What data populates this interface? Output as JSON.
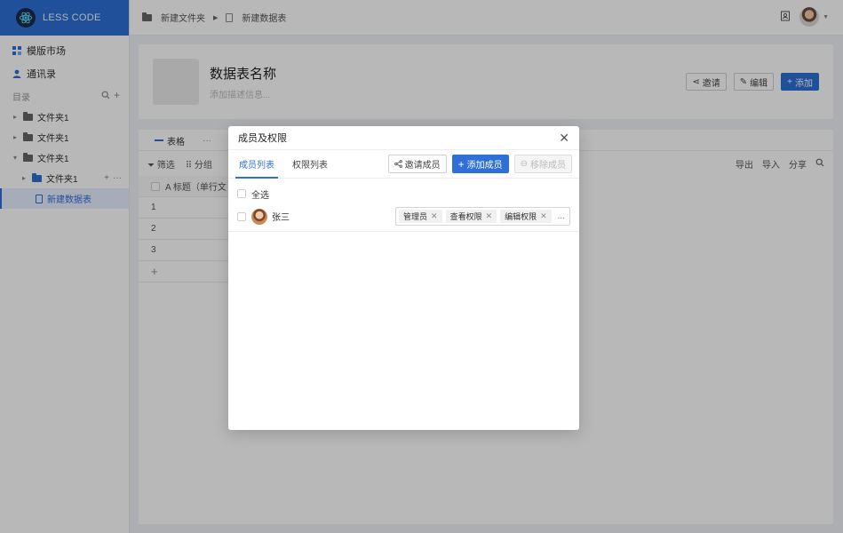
{
  "brand": {
    "name": "LESS CODE"
  },
  "sidebar": {
    "nav": [
      {
        "label": "模版市场",
        "icon": "grid-icon"
      },
      {
        "label": "通讯录",
        "icon": "user-icon"
      }
    ],
    "section_label": "目录",
    "tree": [
      {
        "label": "文件夹1",
        "caret": "▸"
      },
      {
        "label": "文件夹1",
        "caret": "▸"
      },
      {
        "label": "文件夹1",
        "caret": "▾"
      },
      {
        "label": "文件夹1",
        "caret": "▸"
      },
      {
        "label": "新建数据表"
      }
    ]
  },
  "topbar": {
    "crumbs": [
      "新建文件夹",
      "新建数据表"
    ]
  },
  "header": {
    "title": "数据表名称",
    "desc_placeholder": "添加描述信息...",
    "invite": "邀请",
    "edit": "编辑",
    "add": "添加"
  },
  "table": {
    "tab_label": "表格",
    "tab_more": "···",
    "filter": "筛选",
    "group": "分组",
    "export": "导出",
    "import": "导入",
    "share": "分享",
    "col_header": "A  标题（单行文",
    "rows": [
      "1",
      "2",
      "3"
    ],
    "add_row": "+"
  },
  "modal": {
    "title": "成员及权限",
    "tabs": [
      "成员列表",
      "权限列表"
    ],
    "invite_btn": "邀请成员",
    "add_btn": "添加成员",
    "remove_btn": "移除成员",
    "select_all": "全选",
    "member": {
      "name": "张三",
      "permissions": [
        "管理员",
        "查看权限",
        "编辑权限"
      ],
      "more": "..."
    }
  },
  "colors": {
    "primary": "#2f6fd6",
    "brand_bg": "#2f6fd6"
  }
}
